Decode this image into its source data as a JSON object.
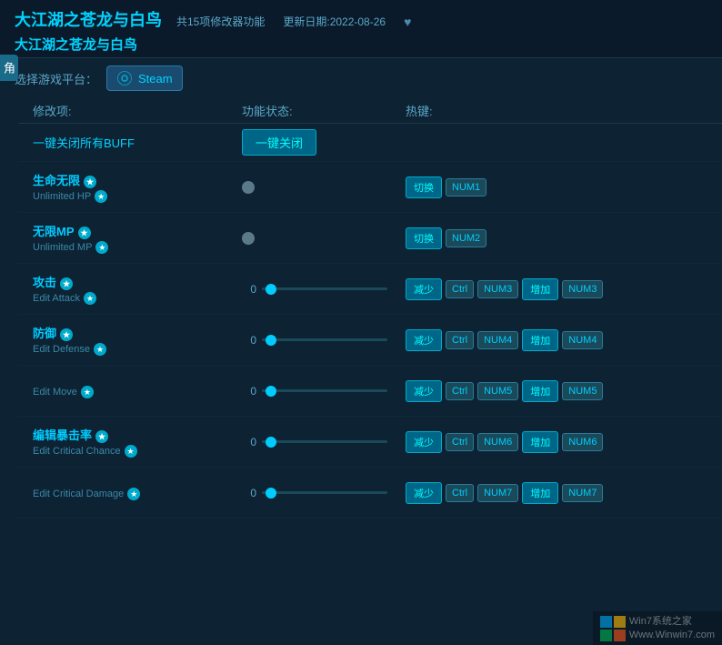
{
  "header": {
    "title_main": "大江湖之苍龙与白鸟",
    "meta_count": "共15项修改器功能",
    "meta_date": "更新日期:2022-08-26",
    "title_sub": "大江湖之苍龙与白鸟"
  },
  "platform": {
    "label": "选择游戏平台：",
    "steam_label": "Steam"
  },
  "side_tab": {
    "label": "角色"
  },
  "table": {
    "col_name": "修改项:",
    "col_status": "功能状态:",
    "col_hotkey": "热键:"
  },
  "one_key": {
    "label": "一键关闭所有BUFF",
    "btn": "一键关闭"
  },
  "rows": [
    {
      "name_zh": "生命无限",
      "name_en": "Unlimited HP",
      "type": "toggle",
      "value": null,
      "hotkeys": [
        {
          "type": "switch",
          "label": "切换"
        },
        {
          "type": "tag",
          "label": "NUM1"
        }
      ]
    },
    {
      "name_zh": "无限MP",
      "name_en": "Unlimited MP",
      "type": "toggle",
      "value": null,
      "hotkeys": [
        {
          "type": "switch",
          "label": "切换"
        },
        {
          "type": "tag",
          "label": "NUM2"
        }
      ]
    },
    {
      "name_zh": "攻击",
      "name_en": "Edit Attack",
      "type": "slider",
      "value": "0",
      "hotkeys": [
        {
          "type": "key",
          "label": "减少"
        },
        {
          "type": "tag",
          "label": "Ctrl"
        },
        {
          "type": "tag",
          "label": "NUM3"
        },
        {
          "type": "key",
          "label": "增加"
        },
        {
          "type": "tag",
          "label": "NUM3"
        }
      ]
    },
    {
      "name_zh": "防御",
      "name_en": "Edit Defense",
      "type": "slider",
      "value": "0",
      "hotkeys": [
        {
          "type": "key",
          "label": "减少"
        },
        {
          "type": "tag",
          "label": "Ctrl"
        },
        {
          "type": "tag",
          "label": "NUM4"
        },
        {
          "type": "key",
          "label": "增加"
        },
        {
          "type": "tag",
          "label": "NUM4"
        }
      ]
    },
    {
      "name_zh": "",
      "name_en": "Edit Move",
      "type": "slider",
      "value": "0",
      "hotkeys": [
        {
          "type": "key",
          "label": "减少"
        },
        {
          "type": "tag",
          "label": "Ctrl"
        },
        {
          "type": "tag",
          "label": "NUM5"
        },
        {
          "type": "key",
          "label": "增加"
        },
        {
          "type": "tag",
          "label": "NUM5"
        }
      ]
    },
    {
      "name_zh": "编辑暴击率",
      "name_en": "Edit Critical Chance",
      "type": "slider",
      "value": "0",
      "hotkeys": [
        {
          "type": "key",
          "label": "减少"
        },
        {
          "type": "tag",
          "label": "Ctrl"
        },
        {
          "type": "tag",
          "label": "NUM6"
        },
        {
          "type": "key",
          "label": "增加"
        },
        {
          "type": "tag",
          "label": "NUM6"
        }
      ]
    },
    {
      "name_zh": "",
      "name_en": "Edit Critical Damage",
      "type": "slider",
      "value": "0",
      "hotkeys": [
        {
          "type": "key",
          "label": "减少"
        },
        {
          "type": "tag",
          "label": "Ctrl"
        },
        {
          "type": "tag",
          "label": "NUM7"
        },
        {
          "type": "key",
          "label": "增加"
        },
        {
          "type": "tag",
          "label": "NUM7"
        }
      ]
    }
  ],
  "watermark": {
    "line1": "Win7系统之家",
    "line2": "Www.Winwin7.com"
  }
}
